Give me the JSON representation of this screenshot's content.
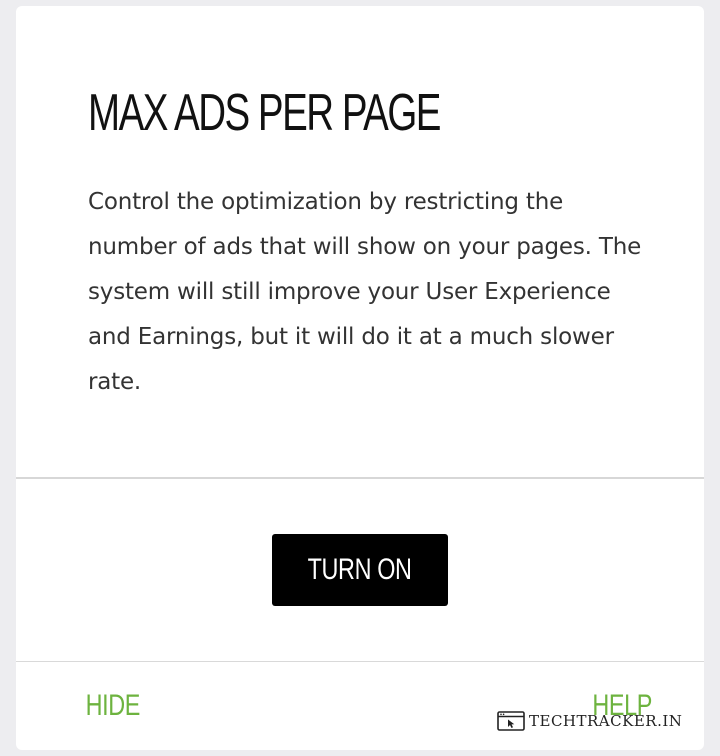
{
  "panel": {
    "title": "MAX ADS PER PAGE",
    "description": "Control the optimization by restricting the number of ads that will show on your pages. The system will still improve your User Experience and Earnings, but it will do it at a much slower rate.",
    "turn_on_label": "TURN ON"
  },
  "footer": {
    "hide_label": "HIDE",
    "help_label": "HELP"
  },
  "watermark": {
    "text": "TECHTRACKER.IN",
    "icon": "browser-window-icon"
  },
  "colors": {
    "background": "#ededf0",
    "card": "#ffffff",
    "button": "#000000",
    "link_accent": "#6db33f"
  }
}
